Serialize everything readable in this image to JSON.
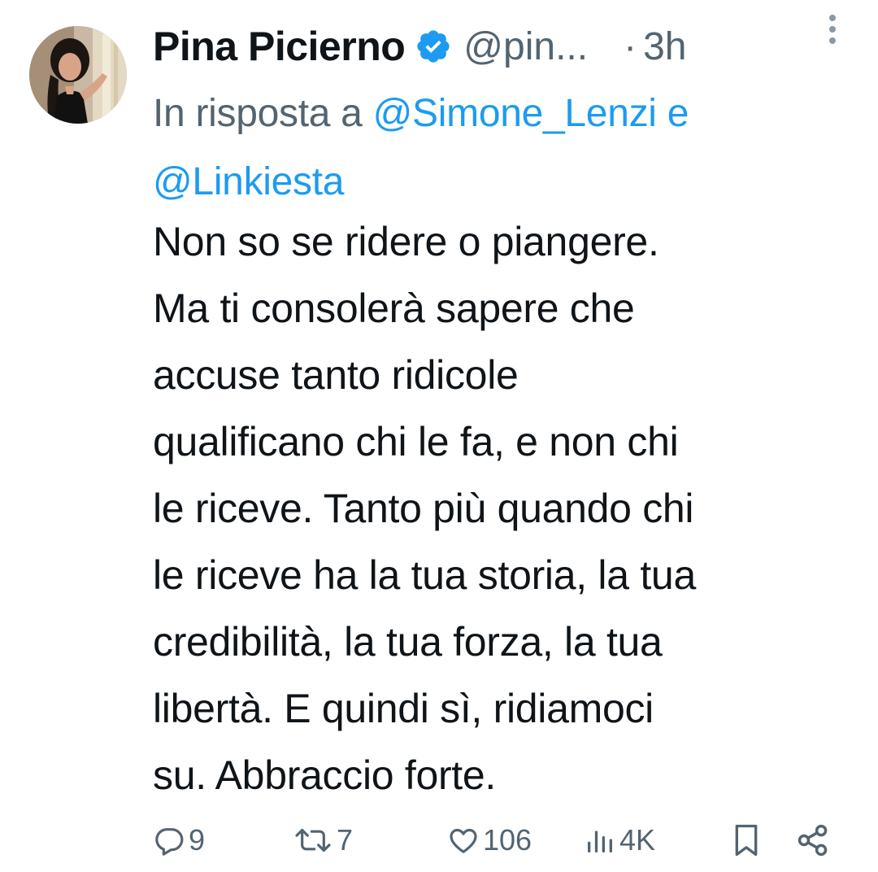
{
  "author": {
    "name": "Pina Picierno",
    "handle": "@pin...",
    "separator": "·",
    "time": "3h",
    "avatar_icon": "profile-photo",
    "verified_icon": "verified-badge-icon"
  },
  "reply": {
    "prefix": "In risposta a",
    "mention_1": "@Simone_Lenzi",
    "conjunction": "e",
    "mention_2": "@Linkiesta"
  },
  "tweet": {
    "lines": [
      "Non so se ridere o piangere.",
      "Ma ti consolerà sapere che",
      "accuse tanto ridicole",
      "qualificano chi le fa, e non chi",
      "le riceve. Tanto più quando chi",
      "le riceve ha la tua storia, la tua",
      "credibilità, la tua forza, la tua",
      "libertà. E quindi sì, ridiamoci",
      "su. Abbraccio forte."
    ]
  },
  "actions": {
    "replies": "9",
    "retweets": "7",
    "likes": "106",
    "views": "4K"
  },
  "colors": {
    "text": "#0f1419",
    "secondary": "#536471",
    "accent": "#1d9bf0"
  }
}
